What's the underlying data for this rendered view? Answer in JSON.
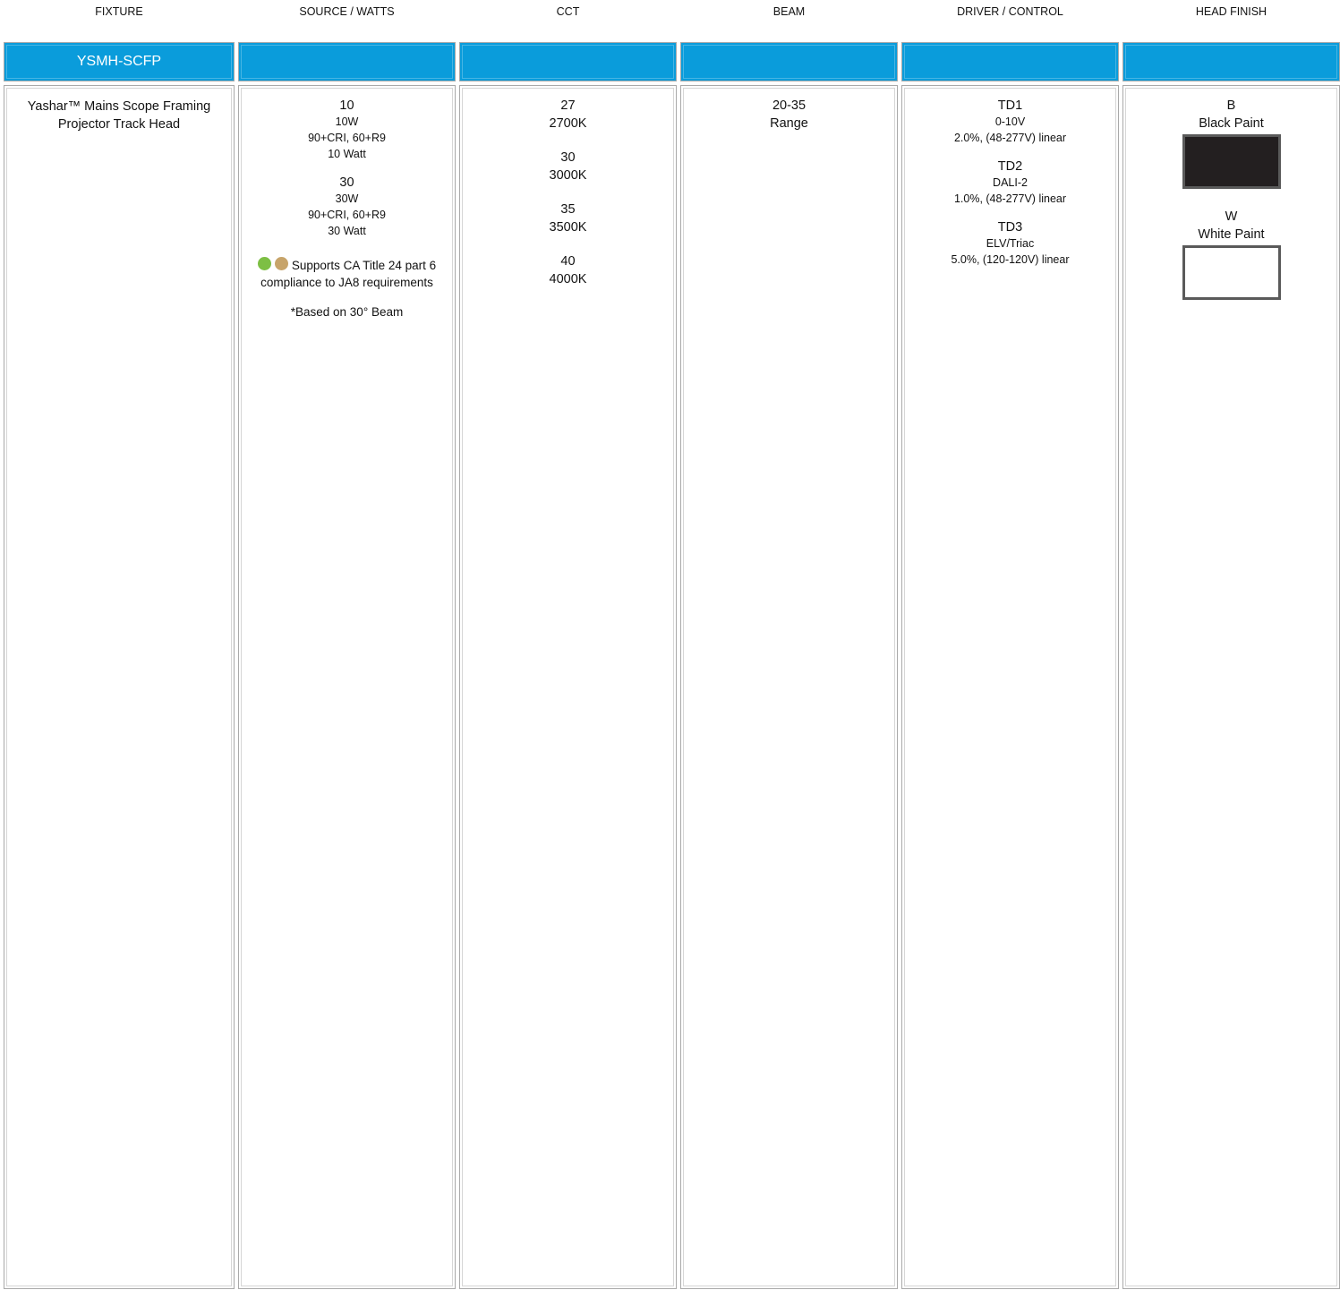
{
  "headers": [
    "FIXTURE",
    "SOURCE / WATTS",
    "CCT",
    "BEAM",
    "DRIVER / CONTROL",
    "HEAD FINISH"
  ],
  "model": "YSMH-SCFP",
  "fixture": {
    "description": "Yashar™ Mains Scope Framing Projector Track Head"
  },
  "source": {
    "options": [
      {
        "code": "10",
        "watts": "10W",
        "cri": "90+CRI,  60+R9",
        "label": "10 Watt"
      },
      {
        "code": "30",
        "watts": "30W",
        "cri": "90+CRI,  60+R9",
        "label": "30 Watt"
      }
    ],
    "compliance": "Supports CA Title 24 part 6 compliance to JA8 requirements",
    "compliance_colors": [
      "#7dbf44",
      "#c7a46a"
    ],
    "footnote": "*Based on 30° Beam"
  },
  "cct": {
    "options": [
      {
        "code": "27",
        "label": "2700K"
      },
      {
        "code": "30",
        "label": "3000K"
      },
      {
        "code": "35",
        "label": "3500K"
      },
      {
        "code": "40",
        "label": "4000K"
      }
    ]
  },
  "beam": {
    "code": "20-35",
    "label": "Range"
  },
  "driver": {
    "options": [
      {
        "code": "TD1",
        "type": "0-10V",
        "spec": "2.0%, (48-277V)  linear"
      },
      {
        "code": "TD2",
        "type": "DALI-2",
        "spec": "1.0%, (48-277V)  linear"
      },
      {
        "code": "TD3",
        "type": "ELV/Triac",
        "spec": "5.0%, (120-120V)  linear"
      }
    ]
  },
  "finish": {
    "options": [
      {
        "code": "B",
        "label": "Black Paint",
        "color": "#231f20"
      },
      {
        "code": "W",
        "label": "White Paint",
        "color": "#ffffff"
      }
    ]
  },
  "colors": {
    "accent": "#0a9cdb",
    "border": "#a9a9a9"
  }
}
